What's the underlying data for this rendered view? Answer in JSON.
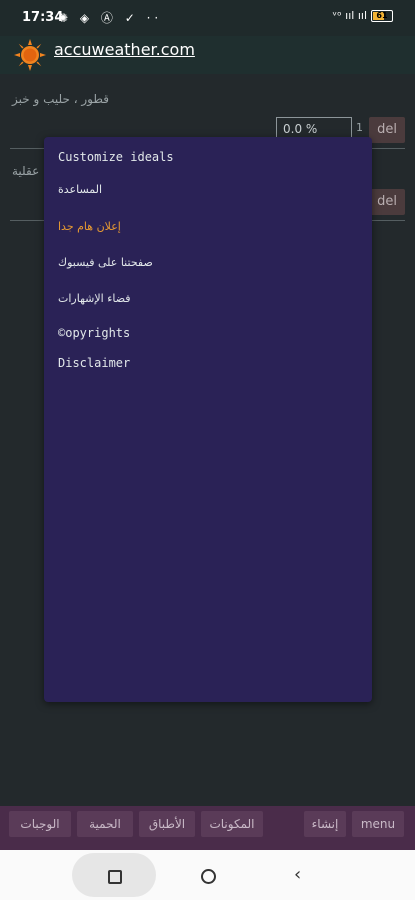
{
  "status_bar": {
    "time": "17:34",
    "left_icons": [
      "gear-icon",
      "wifi-icon",
      "a-icon",
      "check-icon",
      "more-icon"
    ],
    "left_icons_text": "✺ ◈ Ⓐ ✓ ··",
    "signal_text": "ᵛᵒ ııl ııl",
    "battery_level": "61"
  },
  "header": {
    "site": "accuweather.com",
    "logo_color": "#f2841f"
  },
  "background": {
    "item1": "قطور ، حليب و خبز",
    "item1_pct": "0.0 %",
    "item1_num": "1",
    "del_label": "del",
    "item2": "عقلية"
  },
  "menu": {
    "items": [
      {
        "label": "Customize ideals"
      },
      {
        "label": "المساعدة"
      },
      {
        "label": "إعلان هام جدا"
      },
      {
        "label": "صفحتنا على فيسبوك"
      },
      {
        "label": "فضاء الإشهارات"
      },
      {
        "label": "©opyrights"
      },
      {
        "label": "Disclaimer"
      }
    ],
    "highlight_color": "#e79a32",
    "bg_color": "#2a2256"
  },
  "bottom_bar": {
    "buttons": [
      "الوجبات",
      "الحمية",
      "الأطباق",
      "المكونات",
      "إنشاء",
      "menu"
    ]
  },
  "nav": {
    "icons": [
      "recents-icon",
      "home-icon",
      "back-icon"
    ]
  }
}
